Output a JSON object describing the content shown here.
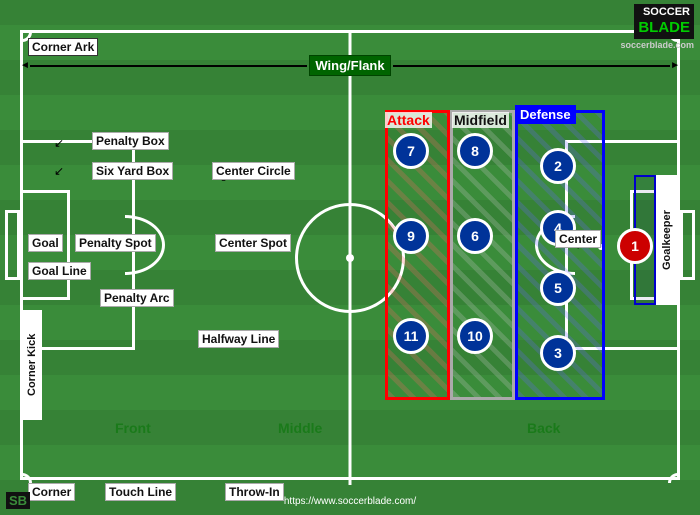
{
  "field": {
    "labels": {
      "corner_ark": "Corner Ark",
      "wing_flank": "Wing/Flank",
      "penalty_box": "Penalty Box",
      "six_yard_box": "Six Yard Box",
      "center_circle": "Center Circle",
      "goal": "Goal",
      "penalty_spot": "Penalty Spot",
      "center_spot": "Center Spot",
      "goal_line": "Goal Line",
      "penalty_arc": "Penalty Arc",
      "halfway_line": "Halfway Line",
      "front": "Front",
      "middle": "Middle",
      "back": "Back",
      "corner": "Corner",
      "touch_line": "Touch Line",
      "throw_in": "Throw-In",
      "corner_kick": "Corner Kick",
      "attack": "Attack",
      "midfield": "Midfield",
      "defense": "Defense",
      "center": "Center",
      "goalkeeper": "Goalkeeper"
    },
    "players": [
      {
        "number": "7",
        "zone": "attack",
        "row": "top"
      },
      {
        "number": "9",
        "zone": "attack",
        "row": "mid"
      },
      {
        "number": "11",
        "zone": "attack",
        "row": "bot"
      },
      {
        "number": "8",
        "zone": "midfield",
        "row": "top"
      },
      {
        "number": "6",
        "zone": "midfield",
        "row": "mid"
      },
      {
        "number": "10",
        "zone": "midfield",
        "row": "bot"
      },
      {
        "number": "2",
        "zone": "defense",
        "row": "top"
      },
      {
        "number": "4",
        "zone": "defense",
        "row": "upper-mid"
      },
      {
        "number": "5",
        "zone": "defense",
        "row": "lower-mid"
      },
      {
        "number": "3",
        "zone": "defense",
        "row": "bot"
      },
      {
        "number": "1",
        "zone": "goalkeeper",
        "row": "mid"
      }
    ],
    "url": "https://www.soccerblade.com/",
    "logo_soccer": "SOCCER",
    "logo_blade": "BLADE"
  }
}
